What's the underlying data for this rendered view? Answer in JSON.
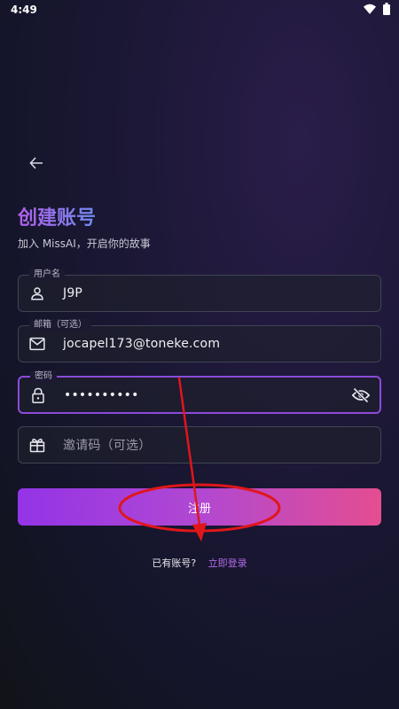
{
  "status": {
    "time": "4:49"
  },
  "page": {
    "title": "创建账号",
    "subtitle": "加入 MissAI，开启你的故事"
  },
  "form": {
    "username": {
      "label": "用户名",
      "value": "J9P"
    },
    "email": {
      "label": "邮箱（可选）",
      "value": "jocapel173@toneke.com"
    },
    "password": {
      "label": "密码",
      "value": "••••••••••"
    },
    "invite": {
      "placeholder": "邀请码（可选）"
    }
  },
  "actions": {
    "register_label": "注册",
    "login_prompt": "已有账号?",
    "login_link": "立即登录"
  },
  "colors": {
    "accent_purple": "#9334e6",
    "accent_pink": "#e44d91",
    "annotation_red": "#e0161b"
  },
  "icons": [
    "wifi-icon",
    "battery-icon",
    "back-arrow-icon",
    "person-icon",
    "mail-icon",
    "lock-icon",
    "eye-off-icon",
    "gift-icon"
  ]
}
